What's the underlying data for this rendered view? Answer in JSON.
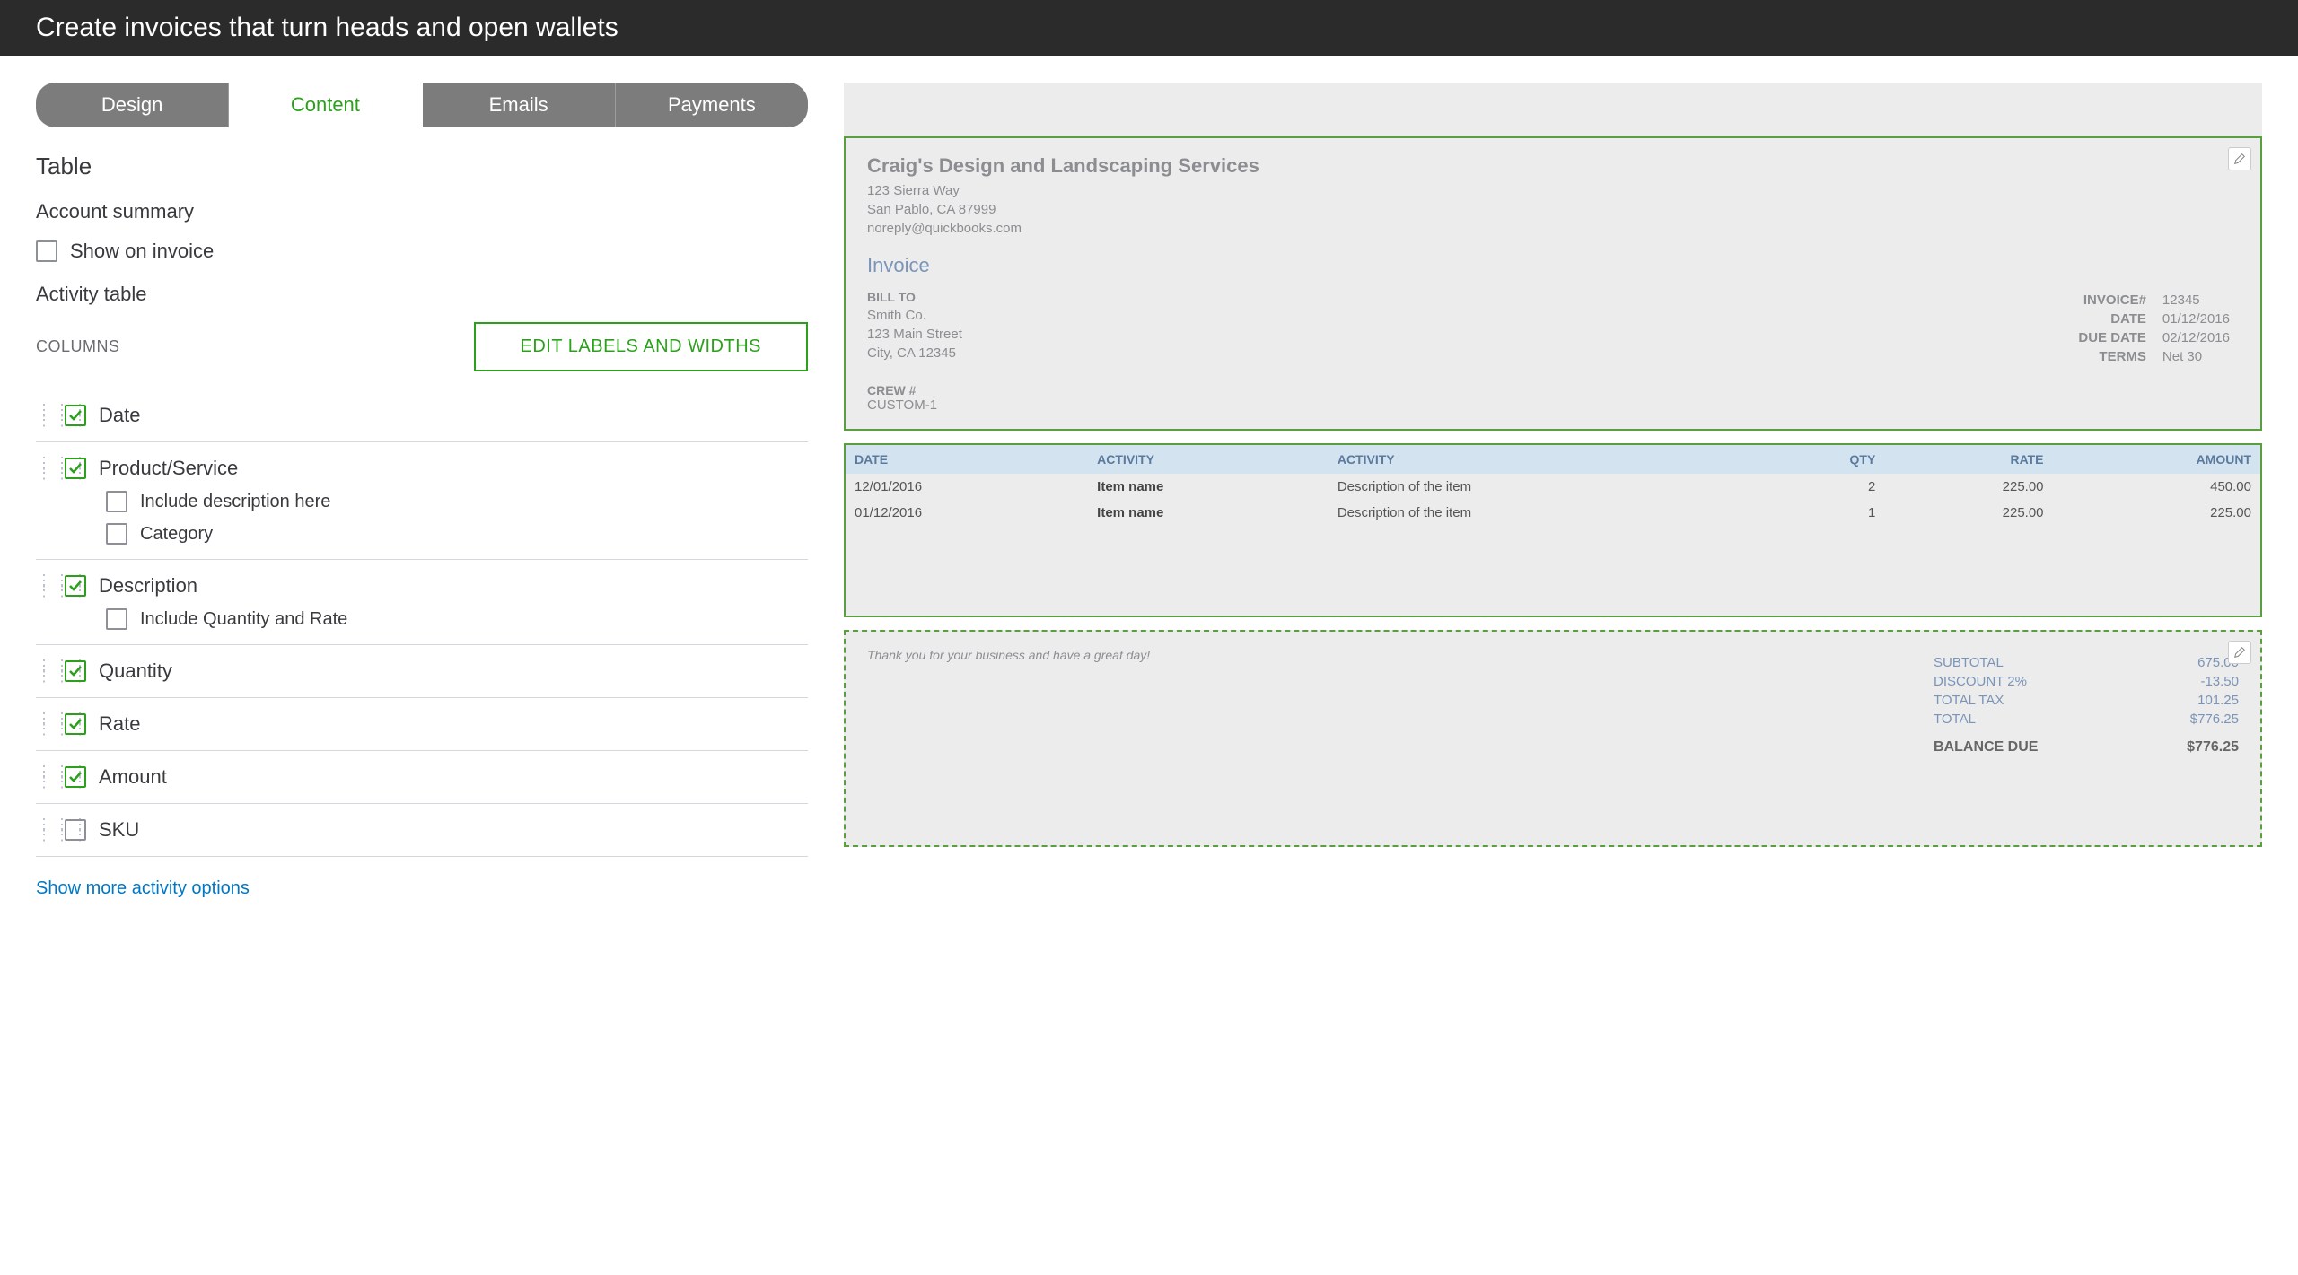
{
  "topbar": {
    "title": "Create invoices that turn heads and open wallets"
  },
  "tabs": [
    "Design",
    "Content",
    "Emails",
    "Payments"
  ],
  "activeTab": "Content",
  "left": {
    "table_heading": "Table",
    "account_summary_label": "Account summary",
    "show_on_invoice_label": "Show on invoice",
    "show_on_invoice_checked": false,
    "activity_table_label": "Activity table",
    "columns_label": "COLUMNS",
    "edit_button": "EDIT LABELS AND WIDTHS",
    "columns": [
      {
        "id": "date",
        "label": "Date",
        "checked": true
      },
      {
        "id": "product",
        "label": "Product/Service",
        "checked": true,
        "subs": [
          {
            "id": "incl-desc",
            "label": "Include description here",
            "checked": false
          },
          {
            "id": "category",
            "label": "Category",
            "checked": false
          }
        ]
      },
      {
        "id": "description",
        "label": "Description",
        "checked": true,
        "subs": [
          {
            "id": "incl-qty-rate",
            "label": "Include Quantity and Rate",
            "checked": false
          }
        ]
      },
      {
        "id": "quantity",
        "label": "Quantity",
        "checked": true
      },
      {
        "id": "rate",
        "label": "Rate",
        "checked": true
      },
      {
        "id": "amount",
        "label": "Amount",
        "checked": true
      },
      {
        "id": "sku",
        "label": "SKU",
        "checked": false
      }
    ],
    "show_more": "Show more activity options"
  },
  "preview": {
    "company": {
      "name": "Craig's Design and Landscaping Services",
      "addr1": "123 Sierra Way",
      "addr2": "San Pablo, CA 87999",
      "email": "noreply@quickbooks.com"
    },
    "invoice_title": "Invoice",
    "billto_label": "BILL TO",
    "billto": {
      "name": "Smith Co.",
      "addr1": "123 Main Street",
      "addr2": "City, CA 12345"
    },
    "meta": [
      {
        "k": "INVOICE#",
        "v": "12345"
      },
      {
        "k": "DATE",
        "v": "01/12/2016"
      },
      {
        "k": "DUE DATE",
        "v": "02/12/2016"
      },
      {
        "k": "TERMS",
        "v": "Net 30"
      }
    ],
    "crew_label": "CREW #",
    "crew_value": "CUSTOM-1",
    "table_headers": [
      "DATE",
      "ACTIVITY",
      "ACTIVITY",
      "QTY",
      "RATE",
      "AMOUNT"
    ],
    "rows": [
      {
        "date": "12/01/2016",
        "item": "Item name",
        "desc": "Description of the item",
        "qty": "2",
        "rate": "225.00",
        "amount": "450.00"
      },
      {
        "date": "01/12/2016",
        "item": "Item name",
        "desc": "Description of the item",
        "qty": "1",
        "rate": "225.00",
        "amount": "225.00"
      }
    ],
    "thank": "Thank you for your business and have a great day!",
    "totals": [
      {
        "k": "SUBTOTAL",
        "v": "675.00",
        "cls": "blue"
      },
      {
        "k": "DISCOUNT 2%",
        "v": "-13.50",
        "cls": "blue"
      },
      {
        "k": "TOTAL TAX",
        "v": "101.25",
        "cls": "blue"
      },
      {
        "k": "TOTAL",
        "v": "$776.25",
        "cls": "blue"
      }
    ],
    "balance": {
      "k": "BALANCE DUE",
      "v": "$776.25"
    }
  }
}
